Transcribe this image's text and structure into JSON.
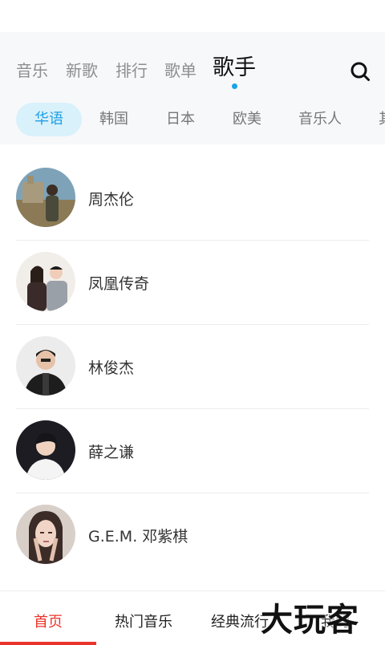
{
  "top_tabs": [
    {
      "label": "音乐"
    },
    {
      "label": "新歌"
    },
    {
      "label": "排行"
    },
    {
      "label": "歌单"
    },
    {
      "label": "歌手"
    }
  ],
  "active_top_tab": "歌手",
  "search": {
    "icon": "search-icon"
  },
  "sub_tabs": [
    {
      "label": "华语"
    },
    {
      "label": "韩国"
    },
    {
      "label": "日本"
    },
    {
      "label": "欧美"
    },
    {
      "label": "音乐人"
    },
    {
      "label": "其"
    }
  ],
  "active_sub_tab": "华语",
  "artists": [
    {
      "name": "周杰伦"
    },
    {
      "name": "凤凰传奇"
    },
    {
      "name": "林俊杰"
    },
    {
      "name": "薛之谦"
    },
    {
      "name": "G.E.M. 邓紫棋"
    }
  ],
  "bottom_nav": [
    {
      "label": "首页"
    },
    {
      "label": "热门音乐"
    },
    {
      "label": "经典流行"
    },
    {
      "label": "我的"
    }
  ],
  "active_bottom_nav": "首页",
  "watermark": "大玩客",
  "colors": {
    "accent_blue": "#1ea0e6",
    "chip_bg": "#d9f1fb",
    "accent_red": "#e8342a"
  }
}
